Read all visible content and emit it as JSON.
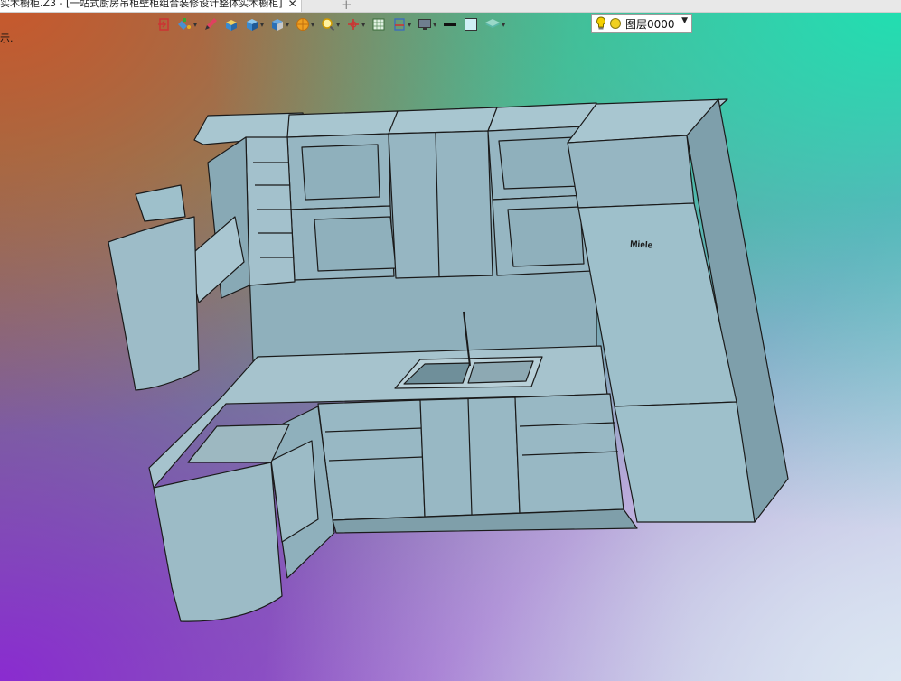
{
  "window": {
    "tab_title": "实木橱柜.Z3 - [一站式厨房吊柜壁柜组合装修设计整体实木橱柜]",
    "close_glyph": "✕",
    "add_glyph": "+"
  },
  "command_prompt": "示.",
  "toolbar": {
    "icons": [
      "exit-icon",
      "paint-bucket-icon",
      "pen-icon",
      "cube-eraser-icon",
      "solid-cube-icon",
      "view-cube-icon",
      "render-sphere-icon",
      "zoom-fit-icon",
      "axis-icon",
      "grid-icon",
      "section-plane-icon",
      "monitor-icon",
      "line-weight-icon",
      "color-swatch-icon",
      "layers-icon"
    ],
    "dropdown_glyph": "▾"
  },
  "layer": {
    "name": "图层0000",
    "arrow": "▼",
    "lightbulb_color": "#f5d000",
    "dot_color": "#f0d020"
  },
  "model": {
    "fridge_brand": "Miele",
    "cabinet_color": "#8fb0bc",
    "edge_color": "#1a1a1a"
  },
  "viewport_colors": {
    "top_right": "#1fe0b0",
    "top_left": "#c8582c",
    "bottom_left": "#8a2bd0",
    "bottom_right": "#dce6f2"
  }
}
